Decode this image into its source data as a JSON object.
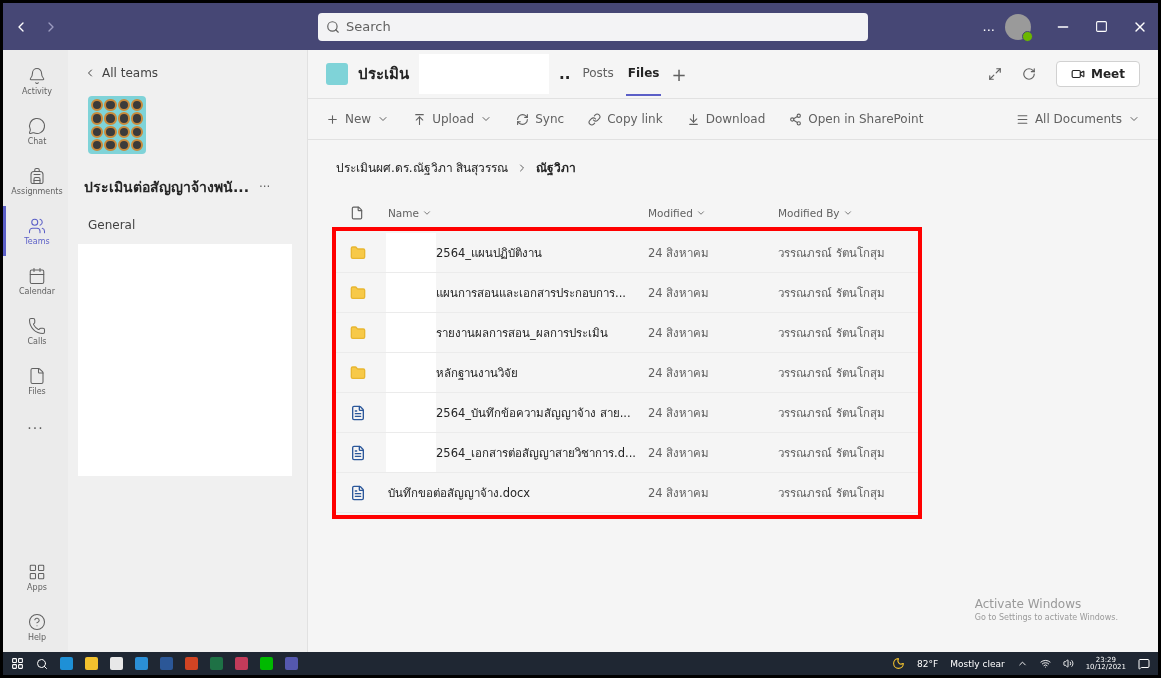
{
  "titlebar": {
    "search": {
      "placeholder": "Search"
    },
    "more": "..."
  },
  "rail": {
    "top": [
      {
        "label": "Activity",
        "selected": false
      },
      {
        "label": "Chat",
        "selected": false
      },
      {
        "label": "Assignments",
        "selected": false
      },
      {
        "label": "Teams",
        "selected": true
      },
      {
        "label": "Calendar",
        "selected": false
      },
      {
        "label": "Calls",
        "selected": false
      },
      {
        "label": "Files",
        "selected": false
      }
    ],
    "more": "...",
    "bottom": [
      {
        "label": "Apps",
        "selected": false
      },
      {
        "label": "Help",
        "selected": false
      }
    ]
  },
  "team_panel": {
    "back": "All teams",
    "team_name": "ประเมินต่อสัญญาจ้างพนั...",
    "more": "···",
    "channels": [
      {
        "name": "General",
        "selected": false
      }
    ],
    "redacted": true
  },
  "header": {
    "team_title": "ประเมิน",
    "title_tail": "..",
    "redacted": true,
    "tabs": [
      {
        "label": "Posts",
        "selected": false
      },
      {
        "label": "Files",
        "selected": true
      }
    ],
    "add_tab": "+",
    "meet": "Meet"
  },
  "toolbar": {
    "actions": [
      {
        "label": "New",
        "dropdown": true
      },
      {
        "label": "Upload",
        "dropdown": true
      },
      {
        "label": "Sync",
        "dropdown": false
      },
      {
        "label": "Copy link",
        "dropdown": false
      },
      {
        "label": "Download",
        "dropdown": false
      },
      {
        "label": "Open in SharePoint",
        "dropdown": false
      }
    ],
    "view": "All Documents"
  },
  "breadcrumb": [
    {
      "label": "ประเมินผศ.ดร.ณัฐวิภา สินสุวรรณ",
      "current": false
    },
    {
      "label": "ณัฐวิภา",
      "current": true
    }
  ],
  "table": {
    "columns": [
      "Name",
      "Modified",
      "Modified By"
    ],
    "rows": [
      {
        "kind": "folder",
        "name": "2564_แผนปฏิบัติงาน",
        "redacted": true,
        "modified": "24 สิงหาคม",
        "modified_by": "วรรณภรณ์ รัตนโกสุม"
      },
      {
        "kind": "folder",
        "name": "แผนการสอนและเอกสารประกอบการ...",
        "redacted": true,
        "modified": "24 สิงหาคม",
        "modified_by": "วรรณภรณ์ รัตนโกสุม"
      },
      {
        "kind": "folder",
        "name": "รายงานผลการสอน_ผลการประเมิน",
        "redacted": true,
        "modified": "24 สิงหาคม",
        "modified_by": "วรรณภรณ์ รัตนโกสุม"
      },
      {
        "kind": "folder",
        "name": "หลักฐานงานวิจัย",
        "redacted": true,
        "modified": "24 สิงหาคม",
        "modified_by": "วรรณภรณ์ รัตนโกสุม"
      },
      {
        "kind": "word",
        "name": "2564_บันทึกข้อความสัญญาจ้าง สาย...",
        "redacted": true,
        "modified": "24 สิงหาคม",
        "modified_by": "วรรณภรณ์ รัตนโกสุม"
      },
      {
        "kind": "word",
        "name": "2564_เอกสารต่อสัญญาสายวิชาการ.d...",
        "redacted": true,
        "modified": "24 สิงหาคม",
        "modified_by": "วรรณภรณ์ รัตนโกสุม"
      },
      {
        "kind": "word",
        "name": "บันทึกขอต่อสัญญาจ้าง.docx",
        "redacted": false,
        "modified": "24 สิงหาคม",
        "modified_by": "วรรณภรณ์ รัตนโกสุม"
      }
    ],
    "highlighted": true
  },
  "activation": {
    "title": "Activate Windows",
    "hint": "Go to Settings to activate Windows."
  },
  "taskbar": {
    "apps": [
      {
        "color": "#1e90d6"
      },
      {
        "color": "#f2c12e"
      },
      {
        "color": "#e8e8e8"
      },
      {
        "color": "#2b8fd6"
      },
      {
        "color": "#2b5797"
      },
      {
        "color": "#d04423"
      },
      {
        "color": "#1e7145"
      },
      {
        "color": "#c23b5a"
      },
      {
        "color": "#00b900"
      },
      {
        "color": "#5558af"
      }
    ],
    "temperature": "82°F",
    "weather": "Mostly clear",
    "time": "23:29",
    "date": "10/12/2021"
  }
}
